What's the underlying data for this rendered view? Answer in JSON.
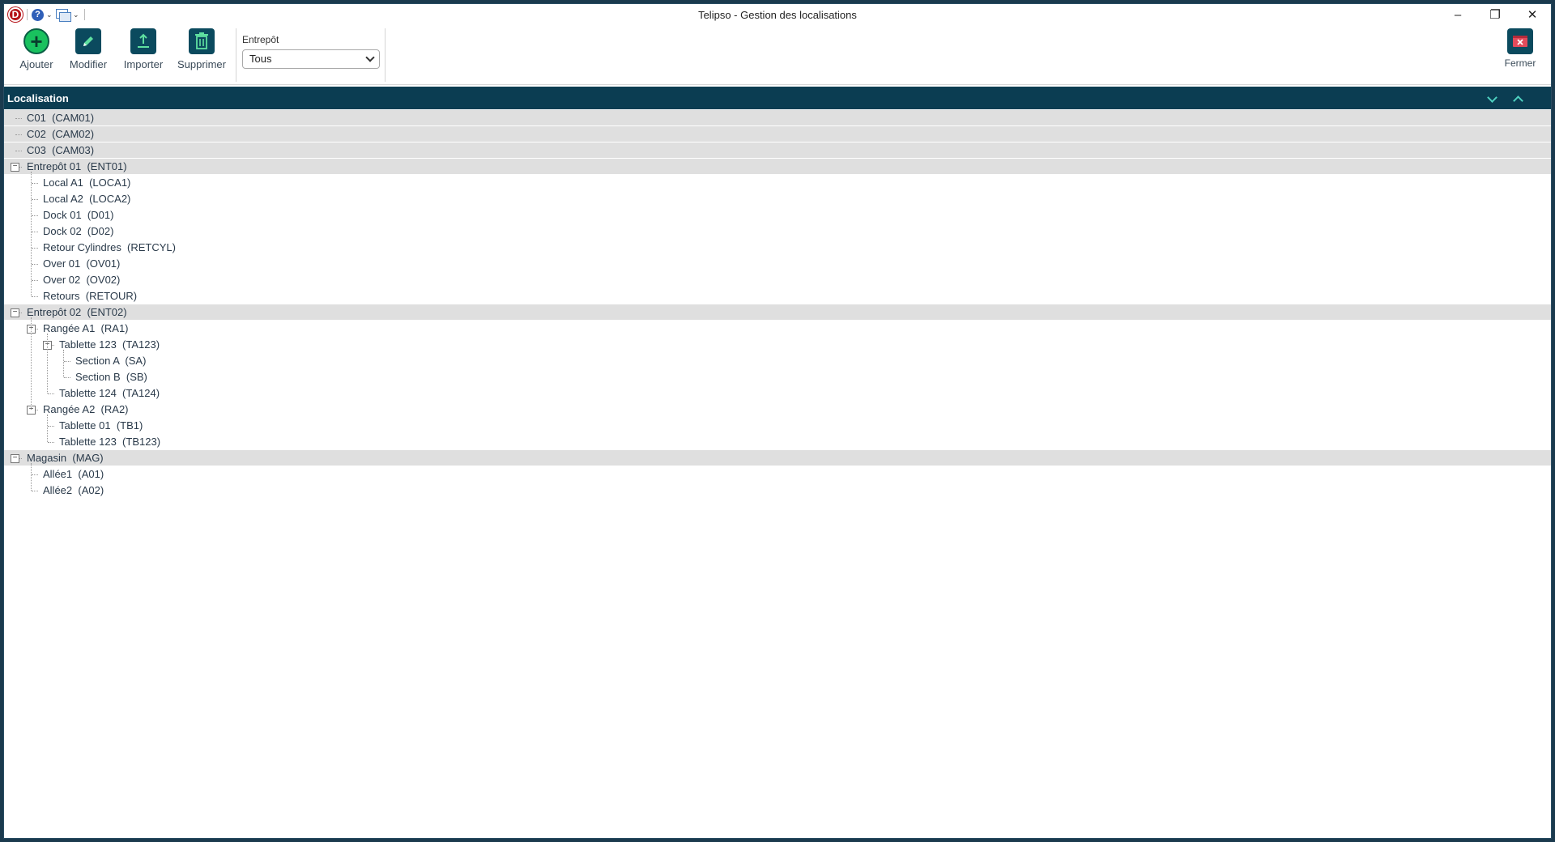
{
  "window": {
    "title": "Telipso - Gestion des localisations",
    "controls": {
      "minimize": "–",
      "restore": "❐",
      "close": "✕"
    }
  },
  "quick_access": {
    "logo_letter": "D",
    "help": "?"
  },
  "toolbar": {
    "add_label": "Ajouter",
    "edit_label": "Modifier",
    "import_label": "Importer",
    "delete_label": "Supprimer",
    "close_label": "Fermer"
  },
  "filter": {
    "label": "Entrepôt",
    "selected": "Tous"
  },
  "section": {
    "title": "Localisation"
  },
  "colors": {
    "header_bg": "#0b3d52",
    "accent": "#0b4a5e",
    "add_green": "#19c15e",
    "row_grey": "#dfdfdf"
  },
  "tree": [
    {
      "text": "C01  (CAM01)",
      "level": 0,
      "group": true,
      "toggle": ""
    },
    {
      "text": "C02  (CAM02)",
      "level": 0,
      "group": true,
      "toggle": ""
    },
    {
      "text": "C03  (CAM03)",
      "level": 0,
      "group": true,
      "toggle": ""
    },
    {
      "text": "Entrepôt 01  (ENT01)",
      "level": 0,
      "group": true,
      "toggle": "−"
    },
    {
      "text": "Local A1  (LOCA1)",
      "level": 1,
      "group": false,
      "toggle": ""
    },
    {
      "text": "Local A2  (LOCA2)",
      "level": 1,
      "group": false,
      "toggle": ""
    },
    {
      "text": "Dock 01  (D01)",
      "level": 1,
      "group": false,
      "toggle": ""
    },
    {
      "text": "Dock 02  (D02)",
      "level": 1,
      "group": false,
      "toggle": ""
    },
    {
      "text": "Retour Cylindres  (RETCYL)",
      "level": 1,
      "group": false,
      "toggle": ""
    },
    {
      "text": "Over 01  (OV01)",
      "level": 1,
      "group": false,
      "toggle": ""
    },
    {
      "text": "Over 02  (OV02)",
      "level": 1,
      "group": false,
      "toggle": ""
    },
    {
      "text": "Retours  (RETOUR)",
      "level": 1,
      "group": false,
      "toggle": ""
    },
    {
      "text": "Entrepôt 02  (ENT02)",
      "level": 0,
      "group": true,
      "toggle": "−"
    },
    {
      "text": "Rangée A1  (RA1)",
      "level": 1,
      "group": false,
      "toggle": "−"
    },
    {
      "text": "Tablette 123  (TA123)",
      "level": 2,
      "group": false,
      "toggle": "−"
    },
    {
      "text": "Section A  (SA)",
      "level": 3,
      "group": false,
      "toggle": ""
    },
    {
      "text": "Section B  (SB)",
      "level": 3,
      "group": false,
      "toggle": ""
    },
    {
      "text": "Tablette 124  (TA124)",
      "level": 2,
      "group": false,
      "toggle": ""
    },
    {
      "text": "Rangée A2  (RA2)",
      "level": 1,
      "group": false,
      "toggle": "−"
    },
    {
      "text": "Tablette 01  (TB1)",
      "level": 2,
      "group": false,
      "toggle": ""
    },
    {
      "text": "Tablette 123  (TB123)",
      "level": 2,
      "group": false,
      "toggle": ""
    },
    {
      "text": "Magasin  (MAG)",
      "level": 0,
      "group": true,
      "toggle": "−"
    },
    {
      "text": "Allée1  (A01)",
      "level": 1,
      "group": false,
      "toggle": ""
    },
    {
      "text": "Allée2  (A02)",
      "level": 1,
      "group": false,
      "toggle": ""
    }
  ]
}
